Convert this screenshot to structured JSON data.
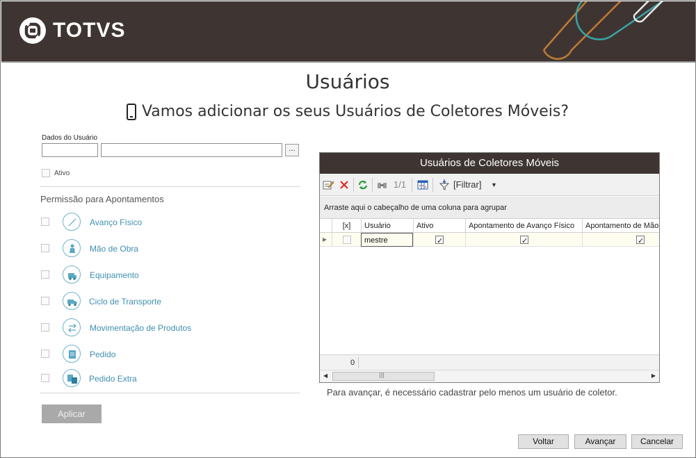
{
  "header": {
    "brand": "TOTVS"
  },
  "page": {
    "title": "Usuários",
    "subtitle": "Vamos adicionar os seus Usuários de Coletores Móveis?"
  },
  "form": {
    "user_data_label": "Dados do Usuário",
    "code_value": "",
    "name_value": "",
    "browse_label": "...",
    "active_label": "Ativo",
    "active_checked": false
  },
  "permissions": {
    "title": "Permissão para Apontamentos",
    "items": [
      {
        "label": "Avanço Físico",
        "icon": "progress-icon",
        "checked": false
      },
      {
        "label": "Mão de Obra",
        "icon": "worker-icon",
        "checked": false
      },
      {
        "label": "Equipamento",
        "icon": "equipment-icon",
        "checked": false
      },
      {
        "label": "Ciclo de Transporte",
        "icon": "truck-icon",
        "checked": false
      },
      {
        "label": "Movimentação de Produtos",
        "icon": "transfer-icon",
        "checked": false
      },
      {
        "label": "Pedido",
        "icon": "order-icon",
        "checked": false
      },
      {
        "label": "Pedido Extra",
        "icon": "extra-order-icon",
        "checked": false
      }
    ],
    "apply_label": "Aplicar"
  },
  "grid": {
    "title": "Usuários de Coletores Móveis",
    "toolbar": {
      "edit_icon": "edit-icon",
      "delete_icon": "delete-icon",
      "refresh_icon": "refresh-icon",
      "find_icon": "binoculars-icon",
      "page_counter": "1/1",
      "columns_icon": "columns-icon",
      "filter_icon": "filter-icon",
      "filter_label": "[Filtrar]"
    },
    "group_hint": "Arraste aqui o cabeçalho de uma coluna para agrupar",
    "columns": [
      "[x]",
      "Usuário",
      "Ativo",
      "Apontamento de Avanço Físico",
      "Apontamento de Mão-"
    ],
    "rows": [
      {
        "selected": false,
        "usuario": "mestre",
        "ativo": true,
        "avanco_fisico": true,
        "mao_de_obra": true
      }
    ],
    "footer_count": "0",
    "scroll_grip": "|||"
  },
  "note": "Para avançar, é necessário cadastrar pelo menos um usuário de coletor.",
  "buttons": {
    "back": "Voltar",
    "next": "Avançar",
    "cancel": "Cancelar"
  },
  "colors": {
    "header_bg": "#3e3532",
    "accent": "#3f8fb0",
    "deco_orange": "#c27a36",
    "deco_teal": "#3aa3a8"
  }
}
